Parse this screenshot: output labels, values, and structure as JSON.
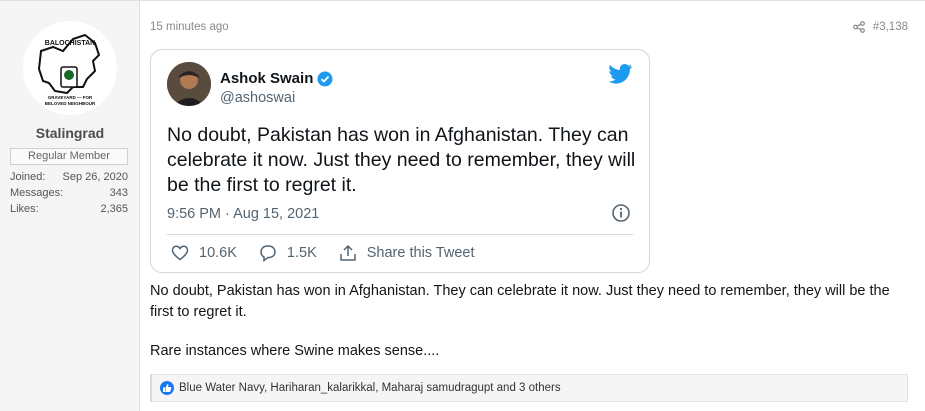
{
  "user": {
    "avatar_text_top": "BALOCHISTAN",
    "avatar_text_bottom1": "GRAVEYARD — FOR",
    "avatar_text_bottom2": "BELOVED NEIGHBOUR",
    "name": "Stalingrad",
    "title": "Regular Member",
    "stats": [
      {
        "label": "Joined:",
        "value": "Sep 26, 2020"
      },
      {
        "label": "Messages:",
        "value": "343"
      },
      {
        "label": "Likes:",
        "value": "2,365"
      }
    ]
  },
  "post": {
    "time": "15 minutes ago",
    "number": "#3,138",
    "tweet": {
      "name": "Ashok Swain",
      "handle": "@ashoswai",
      "text": "No doubt, Pakistan has won in Afghanistan. They can celebrate it now. Just they need to remember, they will be the first to regret it.",
      "datetime": "9:56 PM · Aug 15, 2021",
      "likes": "10.6K",
      "replies": "1.5K",
      "share_label": "Share this Tweet",
      "brand_color": "#1d9bf0"
    },
    "body": "No doubt, Pakistan has won in Afghanistan. They can celebrate it now. Just they need to remember, they will be the first to regret it.",
    "comment": "Rare instances where Swine makes sense....",
    "reactions": "Blue Water Navy, Hariharan_kalarikkal, Maharaj samudragupt and 3 others"
  }
}
